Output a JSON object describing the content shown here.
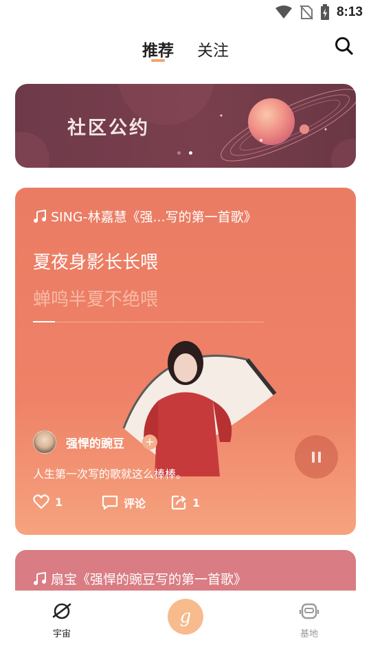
{
  "status_bar": {
    "time": "8:13"
  },
  "header": {
    "tabs": [
      {
        "label": "推荐",
        "active": true
      },
      {
        "label": "关注",
        "active": false
      }
    ],
    "search_icon": "search-icon"
  },
  "banner": {
    "title": "社区公约",
    "dots": 2,
    "active_dot": 2
  },
  "card": {
    "song": "SING-林嘉慧《强...写的第一首歌》",
    "lyric_current": "夏夜身影长长喂",
    "lyric_next": "蝉鸣半夏不绝喂",
    "user": {
      "name": "强悍的豌豆",
      "follow_symbol": "+"
    },
    "description": "人生第一次写的歌就这么棒棒。",
    "actions": {
      "likes": "1",
      "comment_label": "评论",
      "shares": "1"
    }
  },
  "card2": {
    "song": "扇宝《强悍的豌豆写的第一首歌》"
  },
  "bottom_nav": {
    "items": [
      {
        "label": "宇宙",
        "icon": "planet-icon",
        "active": true
      },
      {
        "label": "",
        "icon": "g-logo-icon",
        "center": true,
        "letter": "g"
      },
      {
        "label": "基地",
        "icon": "robot-icon",
        "active": false
      }
    ]
  },
  "colors": {
    "accent": "#f2a46f",
    "card_top": "#ea7c63",
    "card_bottom": "#f6a37e",
    "banner_bg": "#7a3f4d",
    "card2_bg": "#d97c83",
    "center_btn": "#f7bb8e"
  }
}
